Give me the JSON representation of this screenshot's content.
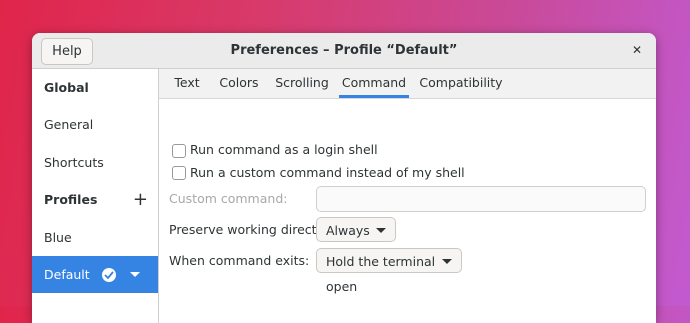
{
  "window": {
    "title": "Preferences – Profile “Default”",
    "help_label": "Help",
    "close_glyph": "✕"
  },
  "sidebar": {
    "global_heading": "Global",
    "items": [
      {
        "label": "General"
      },
      {
        "label": "Shortcuts"
      }
    ],
    "profiles_heading": "Profiles",
    "add_glyph": "+",
    "profiles": [
      {
        "label": "Blue",
        "selected": false
      },
      {
        "label": "Default",
        "selected": true,
        "default_check": true
      }
    ]
  },
  "tabs": [
    {
      "label": "Text",
      "active": false
    },
    {
      "label": "Colors",
      "active": false
    },
    {
      "label": "Scrolling",
      "active": false
    },
    {
      "label": "Command",
      "active": true
    },
    {
      "label": "Compatibility",
      "active": false
    }
  ],
  "command": {
    "login_shell_label": "Run command as a login shell",
    "login_shell_checked": false,
    "custom_command_toggle_label": "Run a custom command instead of my shell",
    "custom_command_toggle_checked": false,
    "custom_command_label": "Custom command:",
    "custom_command_value": "",
    "preserve_dir_label": "Preserve working directory:",
    "preserve_dir_value": "Always",
    "on_exit_label": "When command exits:",
    "on_exit_value": "Hold the terminal open"
  },
  "colors": {
    "accent": "#3584e4"
  }
}
